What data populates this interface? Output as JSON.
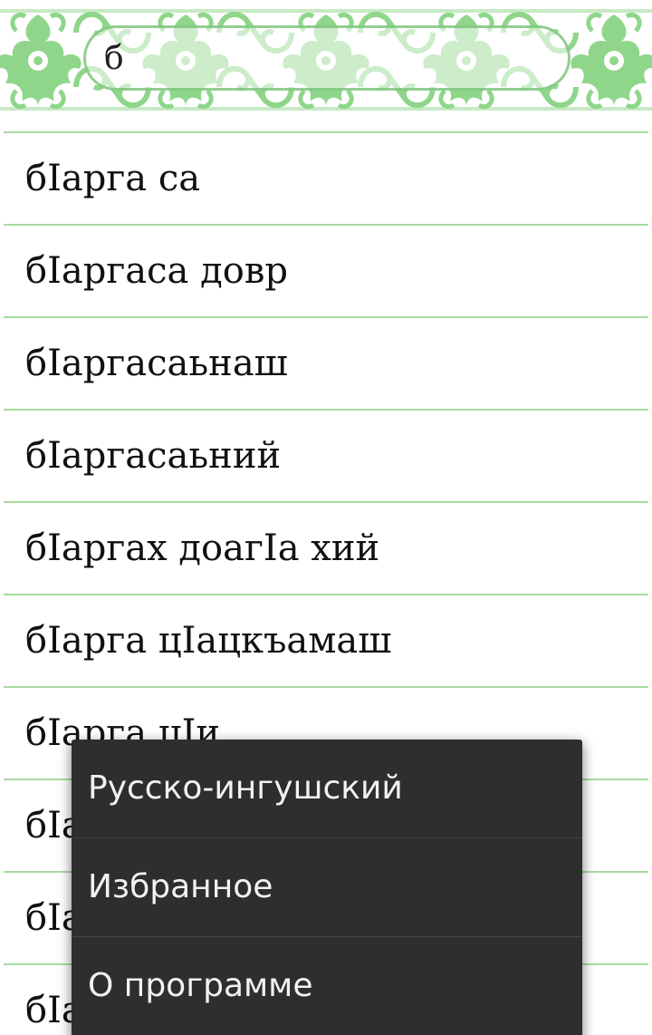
{
  "search": {
    "value": "б",
    "placeholder": ""
  },
  "words": [
    "бIарга са",
    "бIаргаса довр",
    "бIаргасаьнаш",
    "бIаргасаьний",
    "бIаргах доагIа хий",
    "бIарга цIацкъамаш",
    "бIарга цIи",
    "бIа",
    "бIа",
    "бIа"
  ],
  "menu": {
    "items": [
      "Русско-ингушский",
      "Избранное",
      "О программе"
    ]
  },
  "colors": {
    "ornament_green": "#8fd68a",
    "divider_green": "#a8dba0",
    "menu_background": "#2e2e2e"
  }
}
